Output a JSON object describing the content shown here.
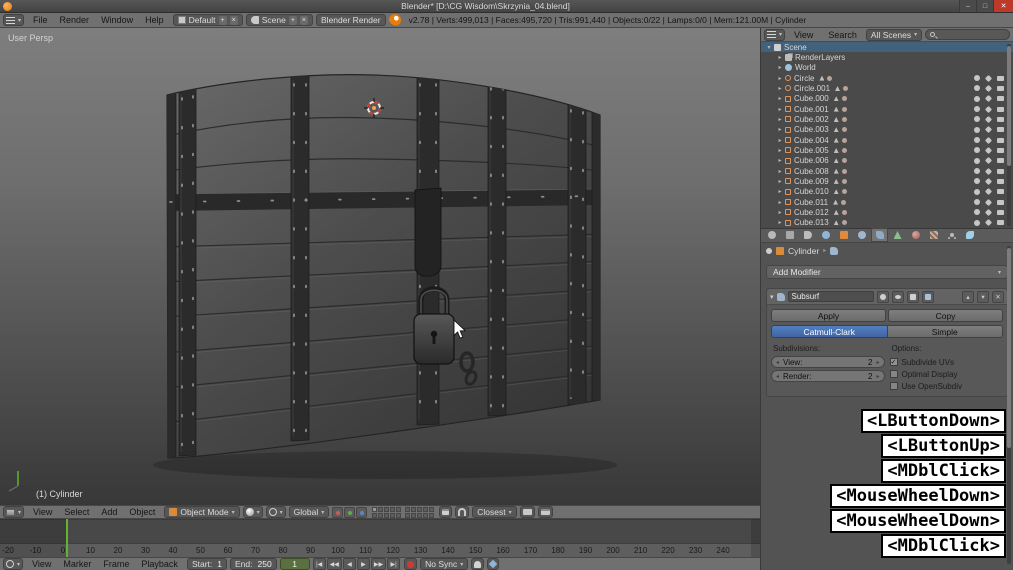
{
  "titlebar": {
    "title": "Blender* [D:\\CG Wisdom\\Skrzynia_04.blend]"
  },
  "infobar": {
    "menus": [
      "File",
      "Render",
      "Window",
      "Help"
    ],
    "layout_selector": "Default",
    "scene_selector": "Scene",
    "engine_selector": "Blender Render",
    "stats": "v2.78 | Verts:499,013 | Faces:495,720 | Tris:991,440 | Objects:0/22 | Lamps:0/0 | Mem:121.00M | Cylinder"
  },
  "viewport": {
    "view_label": "User Persp",
    "active_object_label": "(1) Cylinder",
    "header": {
      "menus": [
        "View",
        "Select",
        "Add",
        "Object"
      ],
      "mode": "Object Mode",
      "orientation": "Global",
      "snap_mode": "Closest"
    }
  },
  "outliner": {
    "header": {
      "view_menu": "View",
      "search_menu": "Search",
      "scope": "All Scenes"
    },
    "rows": [
      {
        "label": "Scene",
        "depth": 0,
        "icon": "scene",
        "expanded": true,
        "selected": true
      },
      {
        "label": "RenderLayers",
        "depth": 1,
        "icon": "renderlayers"
      },
      {
        "label": "World",
        "depth": 1,
        "icon": "world"
      },
      {
        "label": "Circle",
        "depth": 1,
        "icon": "mesh-circle"
      },
      {
        "label": "Circle.001",
        "depth": 1,
        "icon": "mesh-circle"
      },
      {
        "label": "Cube.000",
        "depth": 1,
        "icon": "mesh-cube"
      },
      {
        "label": "Cube.001",
        "depth": 1,
        "icon": "mesh-cube"
      },
      {
        "label": "Cube.002",
        "depth": 1,
        "icon": "mesh-cube"
      },
      {
        "label": "Cube.003",
        "depth": 1,
        "icon": "mesh-cube"
      },
      {
        "label": "Cube.004",
        "depth": 1,
        "icon": "mesh-cube"
      },
      {
        "label": "Cube.005",
        "depth": 1,
        "icon": "mesh-cube"
      },
      {
        "label": "Cube.006",
        "depth": 1,
        "icon": "mesh-cube"
      },
      {
        "label": "Cube.008",
        "depth": 1,
        "icon": "mesh-cube"
      },
      {
        "label": "Cube.009",
        "depth": 1,
        "icon": "mesh-cube"
      },
      {
        "label": "Cube.010",
        "depth": 1,
        "icon": "mesh-cube"
      },
      {
        "label": "Cube.011",
        "depth": 1,
        "icon": "mesh-cube"
      },
      {
        "label": "Cube.012",
        "depth": 1,
        "icon": "mesh-cube"
      },
      {
        "label": "Cube.013",
        "depth": 1,
        "icon": "mesh-cube"
      }
    ]
  },
  "properties": {
    "tabs": [
      "render",
      "render-layers",
      "scene",
      "world",
      "object",
      "constraints",
      "modifiers",
      "data",
      "material",
      "texture",
      "particles",
      "physics"
    ],
    "active_tab": "modifiers",
    "breadcrumb_object": "Cylinder",
    "add_modifier_label": "Add Modifier",
    "modifier": {
      "name": "Subsurf",
      "apply_label": "Apply",
      "copy_label": "Copy",
      "algorithms": [
        "Catmull-Clark",
        "Simple"
      ],
      "active_algorithm": "Catmull-Clark",
      "subdivisions_label": "Subdivisions:",
      "view_field": {
        "label": "View:",
        "value": "2"
      },
      "render_field": {
        "label": "Render:",
        "value": "2"
      },
      "options_label": "Options:",
      "checkboxes": [
        {
          "label": "Subdivide UVs",
          "checked": true
        },
        {
          "label": "Optimal Display",
          "checked": false
        },
        {
          "label": "Use OpenSubdiv",
          "checked": false
        }
      ]
    }
  },
  "timeline": {
    "ticks": [
      -20,
      -10,
      0,
      10,
      20,
      30,
      40,
      50,
      60,
      70,
      80,
      90,
      100,
      110,
      120,
      130,
      140,
      150,
      160,
      170,
      180,
      190,
      200,
      210,
      220,
      230,
      240
    ],
    "current_frame": 1,
    "header": {
      "menus": [
        "View",
        "Marker",
        "Frame",
        "Playback"
      ],
      "start": {
        "label": "Start:",
        "value": "1"
      },
      "end": {
        "label": "End:",
        "value": "250"
      },
      "frame_value": "1",
      "playback": [
        "jump-start",
        "prev-keyframe",
        "play-reverse",
        "play",
        "next-keyframe",
        "jump-end"
      ],
      "sync": "No Sync"
    }
  },
  "screencast_keys": [
    "<LButtonDown>",
    "<LButtonUp>",
    "<MDblClick>",
    "<MouseWheelDown>",
    "<MouseWheelDown>",
    "<MDblClick>"
  ]
}
